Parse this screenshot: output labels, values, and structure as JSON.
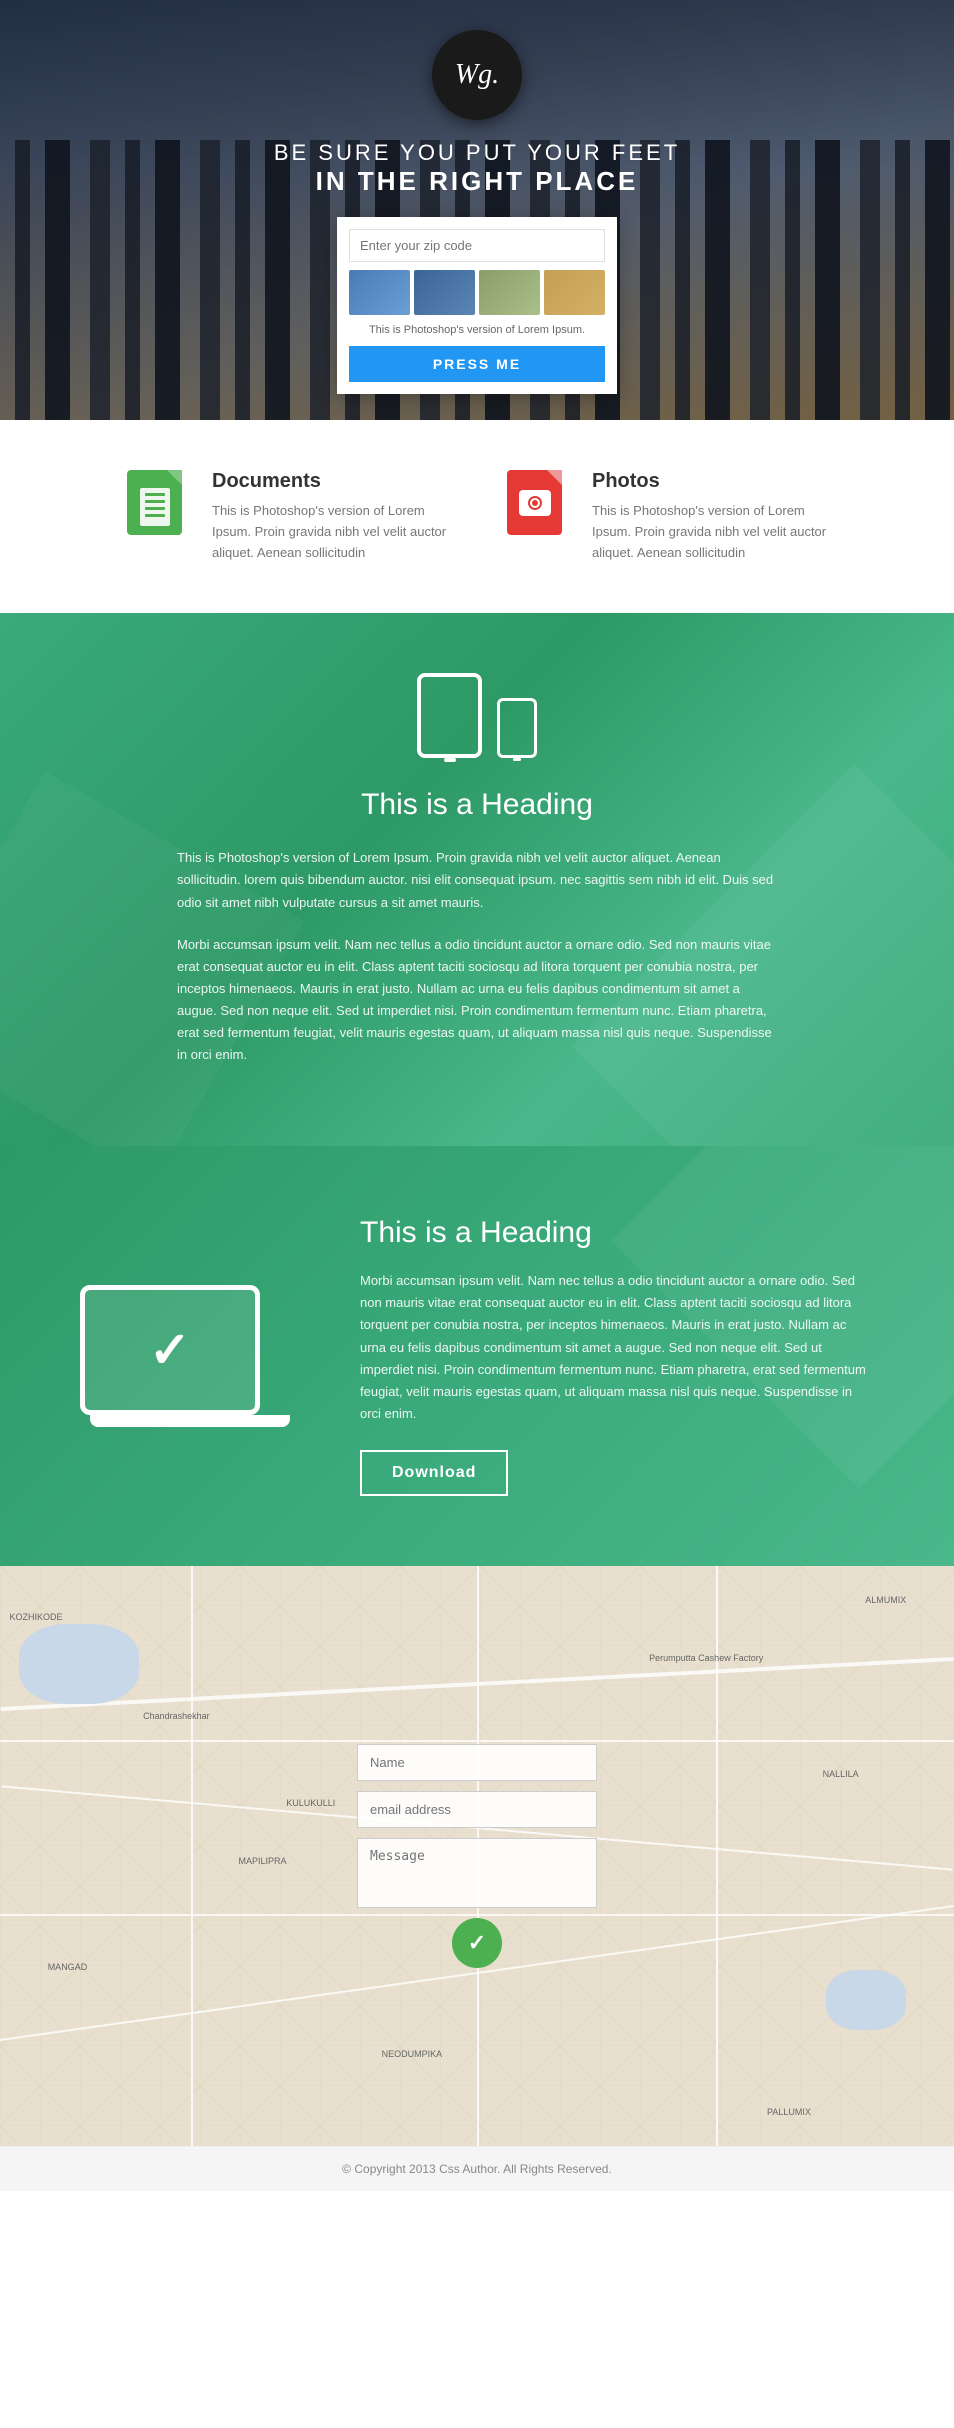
{
  "hero": {
    "logo_text": "Wg.",
    "tagline_line1": "BE SURE YOU PUT YOUR FEET",
    "tagline_line2": "IN THE RIGHT PLACE",
    "input_placeholder": "Enter your zip code",
    "card_text": "This is Photoshop's version of Lorem Ipsum.",
    "button_label": "PRESS ME"
  },
  "features": {
    "item1": {
      "title": "Documents",
      "description": "This is Photoshop's version of Lorem Ipsum. Proin gravida nibh vel velit auctor aliquet. Aenean sollicitudin"
    },
    "item2": {
      "title": "Photos",
      "description": "This is Photoshop's version of Lorem Ipsum. Proin gravida nibh vel velit auctor aliquet. Aenean sollicitudin"
    }
  },
  "green_section_1": {
    "heading": "This is a Heading",
    "para1": "This is Photoshop's version of Lorem Ipsum. Proin gravida nibh vel velit auctor aliquet. Aenean sollicitudin. lorem quis bibendum auctor. nisi elit consequat ipsum. nec sagittis sem nibh id elit. Duis sed odio sit amet nibh vulputate cursus a sit amet mauris.",
    "para2": "Morbi accumsan ipsum velit. Nam nec tellus a odio tincidunt auctor a ornare odio. Sed non mauris vitae erat consequat auctor eu in elit. Class aptent taciti sociosqu ad litora torquent per conubia nostra, per inceptos himenaeos. Mauris in erat justo. Nullam ac urna eu felis dapibus condimentum sit amet a augue. Sed non neque elit. Sed ut imperdiet nisi. Proin condimentum fermentum nunc. Etiam pharetra, erat sed fermentum feugiat, velit mauris egestas quam, ut aliquam massa nisl quis neque. Suspendisse in orci enim."
  },
  "green_section_2": {
    "heading": "This is a Heading",
    "para": "Morbi accumsan ipsum velit. Nam nec tellus a odio tincidunt auctor a ornare odio. Sed non  mauris vitae erat consequat auctor eu in elit. Class aptent taciti sociosqu ad litora torquent per conubia nostra, per inceptos himenaeos. Mauris in erat justo. Nullam ac urna eu felis dapibus condimentum sit amet a augue. Sed non neque elit. Sed ut imperdiet nisi. Proin condimentum fermentum nunc. Etiam pharetra, erat sed fermentum feugiat, velit mauris egestas quam, ut aliquam massa nisl quis neque. Suspendisse in orci enim.",
    "button_label": "Download"
  },
  "contact": {
    "name_placeholder": "Name",
    "email_placeholder": "email address",
    "message_placeholder": "Message"
  },
  "footer": {
    "text": "© Copyright 2013 Css Author. All Rights Reserved."
  }
}
